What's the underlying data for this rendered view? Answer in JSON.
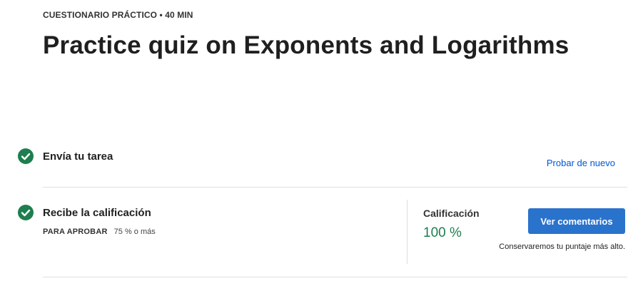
{
  "header": {
    "eyebrow": "CUESTIONARIO PRÁCTICO • 40 MIN",
    "title": "Practice quiz on Exponents and Logarithms"
  },
  "steps": [
    {
      "title": "Envía tu tarea",
      "status_icon": "check-circle-icon",
      "action_link": "Probar de nuevo"
    },
    {
      "title": "Recibe la calificación",
      "status_icon": "check-circle-icon",
      "pass_label": "PARA APROBAR",
      "pass_value": "75 % o más"
    }
  ],
  "grade": {
    "label": "Calificación",
    "value": "100 %",
    "button_label": "Ver comentarios",
    "note": "Conservaremos tu puntaje más alto."
  },
  "colors": {
    "success": "#1e7e4f",
    "link": "#0056d2",
    "primary_button": "#2a73cc"
  }
}
